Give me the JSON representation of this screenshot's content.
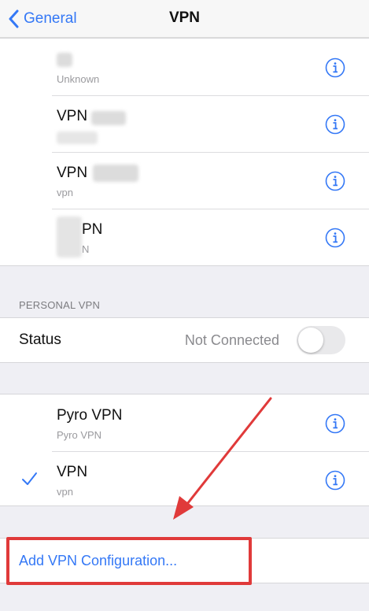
{
  "nav": {
    "back_label": "General",
    "title": "VPN"
  },
  "vpn_list": [
    {
      "title": "",
      "subtitle": "Unknown"
    },
    {
      "title": "VPN",
      "subtitle": ""
    },
    {
      "title": "VPN",
      "subtitle": "vpn"
    },
    {
      "title": "PN",
      "subtitle": "N"
    }
  ],
  "personal_vpn": {
    "header": "PERSONAL VPN",
    "status_label": "Status",
    "status_value": "Not Connected"
  },
  "configs": [
    {
      "title": "Pyro VPN",
      "subtitle": "Pyro VPN",
      "selected": false
    },
    {
      "title": "VPN",
      "subtitle": "vpn",
      "selected": true
    }
  ],
  "add_label": "Add VPN Configuration...",
  "colors": {
    "accent": "#3478f6",
    "annotation": "#e03a3a"
  }
}
